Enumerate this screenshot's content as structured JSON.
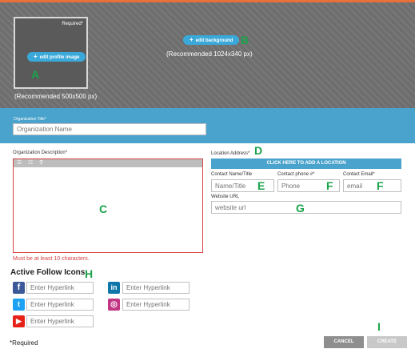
{
  "hero": {
    "required_label": "Required*",
    "profile_button": "edit profile image",
    "profile_recommend": "(Recommended 500x500 px)",
    "background_button": "edit background",
    "background_recommend": "(Recommended 1024x340 px)"
  },
  "annotations": {
    "A": "A",
    "B": "B",
    "C": "C",
    "D": "D",
    "E": "E",
    "F1": "F",
    "F2": "F",
    "G": "G",
    "H": "H",
    "I": "I"
  },
  "org": {
    "title_label": "Organization Title*",
    "title_placeholder": "Organization Name"
  },
  "description": {
    "label": "Organization Description*",
    "error": "Must be at least 10 characters."
  },
  "location": {
    "label": "Location Address*",
    "button": "CLICK HERE TO ADD A LOCATION",
    "contact_name_label": "Contact Name/Title",
    "contact_name_placeholder": "Name/Title",
    "contact_phone_label": "Contact phone #*",
    "contact_phone_placeholder": "Phone",
    "contact_email_label": "Contact Email*",
    "contact_email_placeholder": "email",
    "website_label": "Website URL",
    "website_placeholder": "website url"
  },
  "social": {
    "title": "Active Follow Icons",
    "placeholder": "Enter Hyperlink",
    "icons": [
      "facebook-icon",
      "linkedin-icon",
      "twitter-icon",
      "instagram-icon",
      "youtube-icon"
    ],
    "colors": {
      "facebook": "#3b5998",
      "linkedin": "#0e76a8",
      "twitter": "#1da1f2",
      "instagram": "#c13584",
      "youtube": "#e62117"
    }
  },
  "footer": {
    "required_note": "*Required",
    "cancel": "CANCEL",
    "create": "CREATE"
  }
}
